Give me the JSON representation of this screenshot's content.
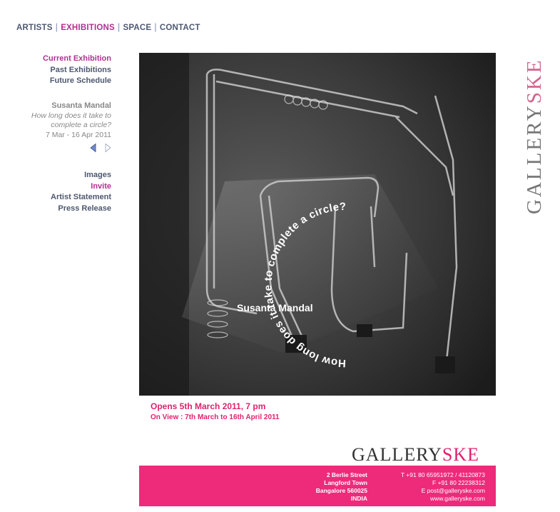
{
  "topnav": {
    "items": [
      {
        "label": "ARTISTS"
      },
      {
        "label": "EXHIBITIONS"
      },
      {
        "label": "SPACE"
      },
      {
        "label": "CONTACT"
      }
    ]
  },
  "sidenav": {
    "items": [
      {
        "label": "Current Exhibition"
      },
      {
        "label": "Past Exhibitions"
      },
      {
        "label": "Future Schedule"
      }
    ]
  },
  "exhibition": {
    "artist": "Susanta Mandal",
    "title_line1": "How long does it take to",
    "title_line2": "complete a circle?",
    "dates": "7 Mar - 16 Apr 2011"
  },
  "sidenav2": {
    "items": [
      {
        "label": "Images"
      },
      {
        "label": "Invite"
      },
      {
        "label": "Artist Statement"
      },
      {
        "label": "Press Release"
      }
    ]
  },
  "logo": {
    "part1": "GALLERY",
    "part2": "SKE"
  },
  "invite": {
    "artist": "Susanta Mandal",
    "circle_text": "How long does it take to complete a circle?",
    "opens": "Opens 5th March 2011, 7 pm",
    "on_view": "On View : 7th March to 16th April 2011"
  },
  "footer": {
    "address": [
      "2 Berlie Street",
      "Langford Town",
      "Bangalore 560025",
      "INDIA"
    ],
    "contact": [
      "T +91 80 65951972 / 41120873",
      "F +91 80 22238312",
      "E post@galleryske.com",
      "www.galleryske.com"
    ]
  },
  "colors": {
    "accent": "#b0308f",
    "pink": "#ee2a7b",
    "nav": "#4d5870"
  }
}
